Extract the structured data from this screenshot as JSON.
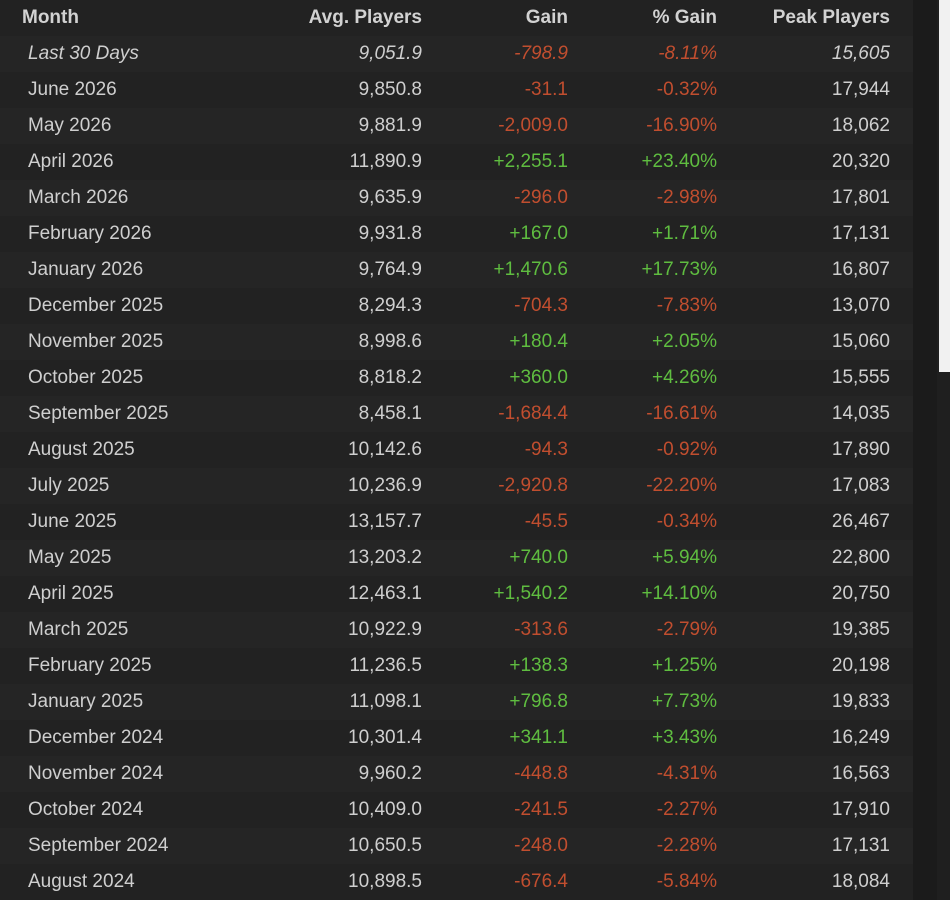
{
  "table": {
    "headers": {
      "month": "Month",
      "avg": "Avg. Players",
      "gain": "Gain",
      "pct": "% Gain",
      "peak": "Peak Players"
    },
    "rows": [
      {
        "month": "Last 30 Days",
        "avg": "9,051.9",
        "gain": "-798.9",
        "pct": "-8.11%",
        "peak": "15,605"
      },
      {
        "month": "June 2026",
        "avg": "9,850.8",
        "gain": "-31.1",
        "pct": "-0.32%",
        "peak": "17,944"
      },
      {
        "month": "May 2026",
        "avg": "9,881.9",
        "gain": "-2,009.0",
        "pct": "-16.90%",
        "peak": "18,062"
      },
      {
        "month": "April 2026",
        "avg": "11,890.9",
        "gain": "+2,255.1",
        "pct": "+23.40%",
        "peak": "20,320"
      },
      {
        "month": "March 2026",
        "avg": "9,635.9",
        "gain": "-296.0",
        "pct": "-2.98%",
        "peak": "17,801"
      },
      {
        "month": "February 2026",
        "avg": "9,931.8",
        "gain": "+167.0",
        "pct": "+1.71%",
        "peak": "17,131"
      },
      {
        "month": "January 2026",
        "avg": "9,764.9",
        "gain": "+1,470.6",
        "pct": "+17.73%",
        "peak": "16,807"
      },
      {
        "month": "December 2025",
        "avg": "8,294.3",
        "gain": "-704.3",
        "pct": "-7.83%",
        "peak": "13,070"
      },
      {
        "month": "November 2025",
        "avg": "8,998.6",
        "gain": "+180.4",
        "pct": "+2.05%",
        "peak": "15,060"
      },
      {
        "month": "October 2025",
        "avg": "8,818.2",
        "gain": "+360.0",
        "pct": "+4.26%",
        "peak": "15,555"
      },
      {
        "month": "September 2025",
        "avg": "8,458.1",
        "gain": "-1,684.4",
        "pct": "-16.61%",
        "peak": "14,035"
      },
      {
        "month": "August 2025",
        "avg": "10,142.6",
        "gain": "-94.3",
        "pct": "-0.92%",
        "peak": "17,890"
      },
      {
        "month": "July 2025",
        "avg": "10,236.9",
        "gain": "-2,920.8",
        "pct": "-22.20%",
        "peak": "17,083"
      },
      {
        "month": "June 2025",
        "avg": "13,157.7",
        "gain": "-45.5",
        "pct": "-0.34%",
        "peak": "26,467"
      },
      {
        "month": "May 2025",
        "avg": "13,203.2",
        "gain": "+740.0",
        "pct": "+5.94%",
        "peak": "22,800"
      },
      {
        "month": "April 2025",
        "avg": "12,463.1",
        "gain": "+1,540.2",
        "pct": "+14.10%",
        "peak": "20,750"
      },
      {
        "month": "March 2025",
        "avg": "10,922.9",
        "gain": "-313.6",
        "pct": "-2.79%",
        "peak": "19,385"
      },
      {
        "month": "February 2025",
        "avg": "11,236.5",
        "gain": "+138.3",
        "pct": "+1.25%",
        "peak": "20,198"
      },
      {
        "month": "January 2025",
        "avg": "11,098.1",
        "gain": "+796.8",
        "pct": "+7.73%",
        "peak": "19,833"
      },
      {
        "month": "December 2024",
        "avg": "10,301.4",
        "gain": "+341.1",
        "pct": "+3.43%",
        "peak": "16,249"
      },
      {
        "month": "November 2024",
        "avg": "9,960.2",
        "gain": "-448.8",
        "pct": "-4.31%",
        "peak": "16,563"
      },
      {
        "month": "October 2024",
        "avg": "10,409.0",
        "gain": "-241.5",
        "pct": "-2.27%",
        "peak": "17,910"
      },
      {
        "month": "September 2024",
        "avg": "10,650.5",
        "gain": "-248.0",
        "pct": "-2.28%",
        "peak": "17,131"
      },
      {
        "month": "August 2024",
        "avg": "10,898.5",
        "gain": "-676.4",
        "pct": "-5.84%",
        "peak": "18,084"
      }
    ]
  },
  "colors": {
    "positive": "#5fbd40",
    "negative": "#c14e2f",
    "text": "#cfcfcf",
    "header": "#d2d2d2",
    "background": "#222222"
  }
}
